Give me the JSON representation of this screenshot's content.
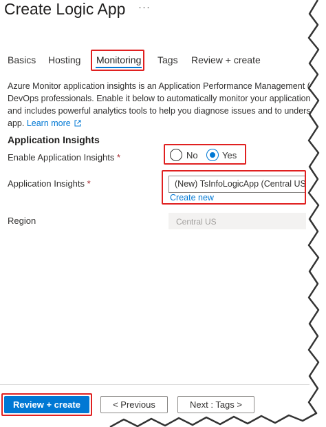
{
  "header": {
    "title": "Create Logic App",
    "more": "···"
  },
  "tabs": [
    {
      "label": "Basics",
      "active": false
    },
    {
      "label": "Hosting",
      "active": false
    },
    {
      "label": "Monitoring",
      "active": true
    },
    {
      "label": "Tags",
      "active": false
    },
    {
      "label": "Review + create",
      "active": false
    }
  ],
  "description": {
    "line1": "Azure Monitor application insights is an Application Performance Management (A",
    "line2": "DevOps professionals. Enable it below to automatically monitor your application. It",
    "line3": "and includes powerful analytics tools to help you diagnose issues and to understa",
    "line4_prefix": "app.",
    "learn_more": "Learn more"
  },
  "app_insights": {
    "section_title": "Application Insights",
    "enable_label": "Enable Application Insights",
    "required_mark": "*",
    "options": [
      {
        "label": "No",
        "selected": false
      },
      {
        "label": "Yes",
        "selected": true
      }
    ],
    "resource_label": "Application Insights",
    "resource_value": "(New) TsInfoLogicApp (Central US)",
    "create_new": "Create new",
    "region_label": "Region",
    "region_value": "Central US"
  },
  "footer": {
    "primary": "Review + create",
    "previous": "< Previous",
    "next": "Next : Tags >"
  },
  "colors": {
    "accent": "#0078d4",
    "highlight": "#e02020",
    "required": "#a4262c"
  }
}
